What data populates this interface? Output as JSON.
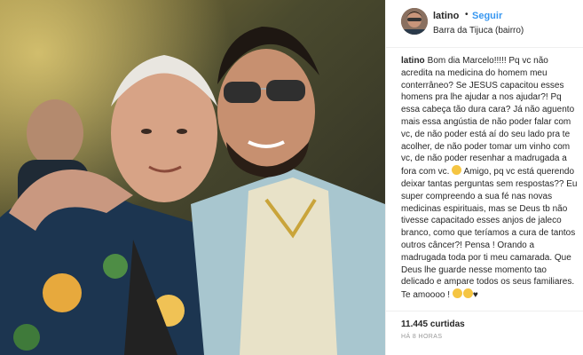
{
  "post": {
    "username": "latino",
    "separator": "•",
    "follow_label": "Seguir",
    "location": "Barra da Tijuca (bairro)",
    "caption_user": "latino",
    "caption_text": "Bom dia Marcelo!!!!! Pq vc não acredita na medicina do homem meu conterrâneo? Se JESUS capacitou esses homens pra lhe ajudar a nos ajudar?! Pq essa cabeça tão dura cara? Já não aguento mais essa angústia de não poder falar com vc, de não poder está aí do seu lado pra te acolher, de não poder tomar um vinho com vc, de não poder resenhar a madrugada a fora com vc.",
    "caption_text_2": "Amigo, pq vc está querendo deixar tantas perguntas sem respostas?? Eu super compreendo a sua fé nas novas medicinas espirituais, mas se Deus tb não tivesse capacitado esses anjos de jaleco branco, como que teríamos a cura de tantos outros câncer?! Pensa ! Orando a madrugada toda por ti meu camarada. Que Deus lhe guarde nesse momento tao delicado e ampare todos os seus familiares. Te amoooo !",
    "caption_end": "♥",
    "likes": "11.445 curtidas",
    "time_ago": "HÁ 8 HORAS"
  },
  "icons": {
    "caption_emoji_1": "worried-face-icon",
    "caption_emoji_2": "grinning-face-icon",
    "caption_emoji_3": "heart-icon"
  },
  "colors": {
    "follow": "#3897f0",
    "text": "#262626",
    "muted": "#999999",
    "border": "#efefef"
  }
}
